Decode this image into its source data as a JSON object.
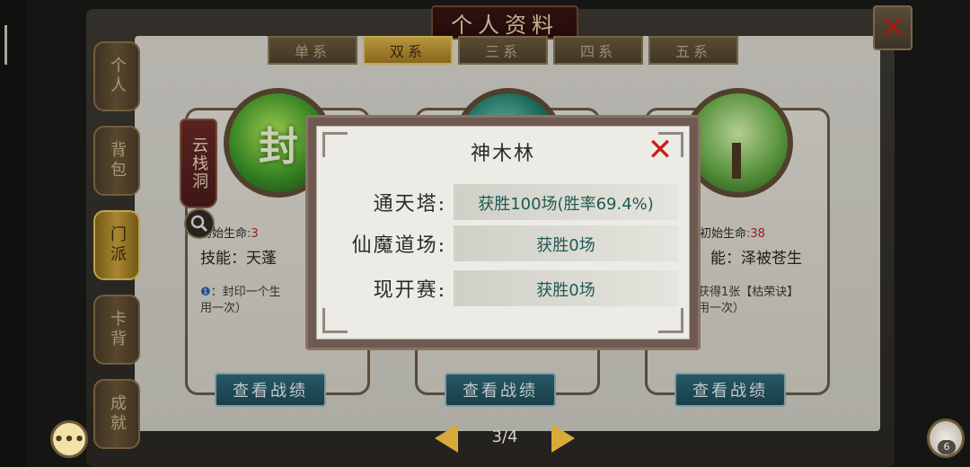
{
  "header": {
    "title": "个人资料"
  },
  "sidebar": {
    "items": [
      {
        "label": "个人"
      },
      {
        "label": "背包"
      },
      {
        "label": "门派"
      },
      {
        "label": "卡背"
      },
      {
        "label": "成就"
      }
    ]
  },
  "tabs": [
    {
      "label": "单系"
    },
    {
      "label": "双系"
    },
    {
      "label": "三系"
    },
    {
      "label": "四系"
    },
    {
      "label": "五系"
    }
  ],
  "banner": {
    "label": "云栈洞"
  },
  "cards": [
    {
      "orb_text": "封",
      "life_label": "初始生命",
      "life_value": ":3",
      "skill": "技能：天蓬",
      "desc_icon": "❶",
      "desc": "：封印一个生",
      "desc2": "用一次）",
      "button": "查看战绩"
    },
    {
      "orb_text": "",
      "life_label": "",
      "life_value": "",
      "skill": "",
      "desc_icon": "",
      "desc": "",
      "desc2": "",
      "button": "查看战绩"
    },
    {
      "orb_text": "",
      "life_label": "初始生命",
      "life_value": ":38",
      "skill": "能：泽被苍生",
      "desc_icon": "",
      "desc": "获得1张【枯荣诀】",
      "desc2": "用一次）",
      "button": "查看战绩"
    }
  ],
  "modal": {
    "title": "神木林",
    "rows": [
      {
        "label": "通天塔:",
        "value": "获胜100场(胜率69.4%)"
      },
      {
        "label": "仙魔道场:",
        "value": "获胜0场"
      },
      {
        "label": "现开赛:",
        "value": "获胜0场"
      }
    ]
  },
  "pager": {
    "text": "3/4"
  },
  "friends": {
    "count": "6"
  },
  "colors": {
    "accent_gold": "#d8aa3a",
    "value_text": "#1e5a52",
    "close_red": "#c3201c"
  },
  "icons": {
    "close": "close-icon",
    "search": "search-icon",
    "chat": "chat-icon",
    "friends": "friends-icon"
  }
}
